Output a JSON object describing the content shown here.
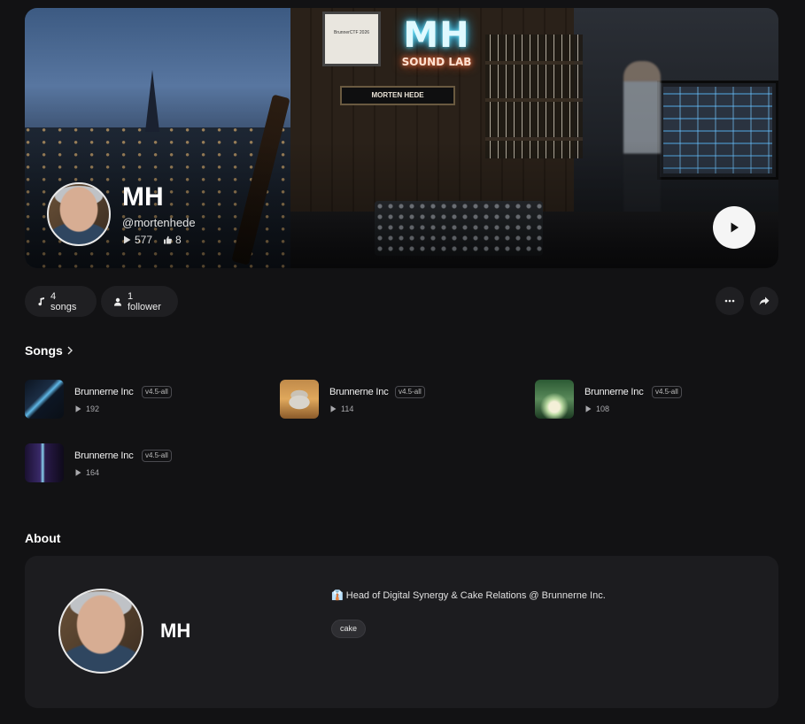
{
  "banner": {
    "neon_title": "MH",
    "neon_subtitle": "SOUND LAB",
    "plaque_text": "MORTEN HEDE",
    "certificate_text": "BrunnerCTF 2026"
  },
  "artist": {
    "name": "MH",
    "handle": "@mortenhede",
    "plays": "577",
    "likes": "8"
  },
  "actions": {
    "songs_label": "4 songs",
    "followers_label": "1 follower"
  },
  "sections": {
    "songs_title": "Songs",
    "about_title": "About"
  },
  "songs": [
    {
      "title": "Brunnerne Inc",
      "version": "v4.5-all",
      "plays": "192"
    },
    {
      "title": "Brunnerne Inc",
      "version": "v4.5-all",
      "plays": "114"
    },
    {
      "title": "Brunnerne Inc",
      "version": "v4.5-all",
      "plays": "108"
    },
    {
      "title": "Brunnerne Inc",
      "version": "v4.5-all",
      "plays": "164"
    }
  ],
  "about": {
    "name": "MH",
    "bio": "👔 Head of Digital Synergy & Cake Relations @ Brunnerne Inc.",
    "tags": [
      "cake"
    ]
  },
  "colors": {
    "background": "#121214",
    "card": "#1c1c1f",
    "pill": "#1f1f22",
    "play_button": "#f5f5f5"
  },
  "icons": {
    "play": "play-icon",
    "like": "thumbs-up-icon",
    "music_note": "music-note-icon",
    "user": "user-icon",
    "more": "more-dots-icon",
    "share": "share-icon",
    "chevron": "chevron-right-icon"
  }
}
